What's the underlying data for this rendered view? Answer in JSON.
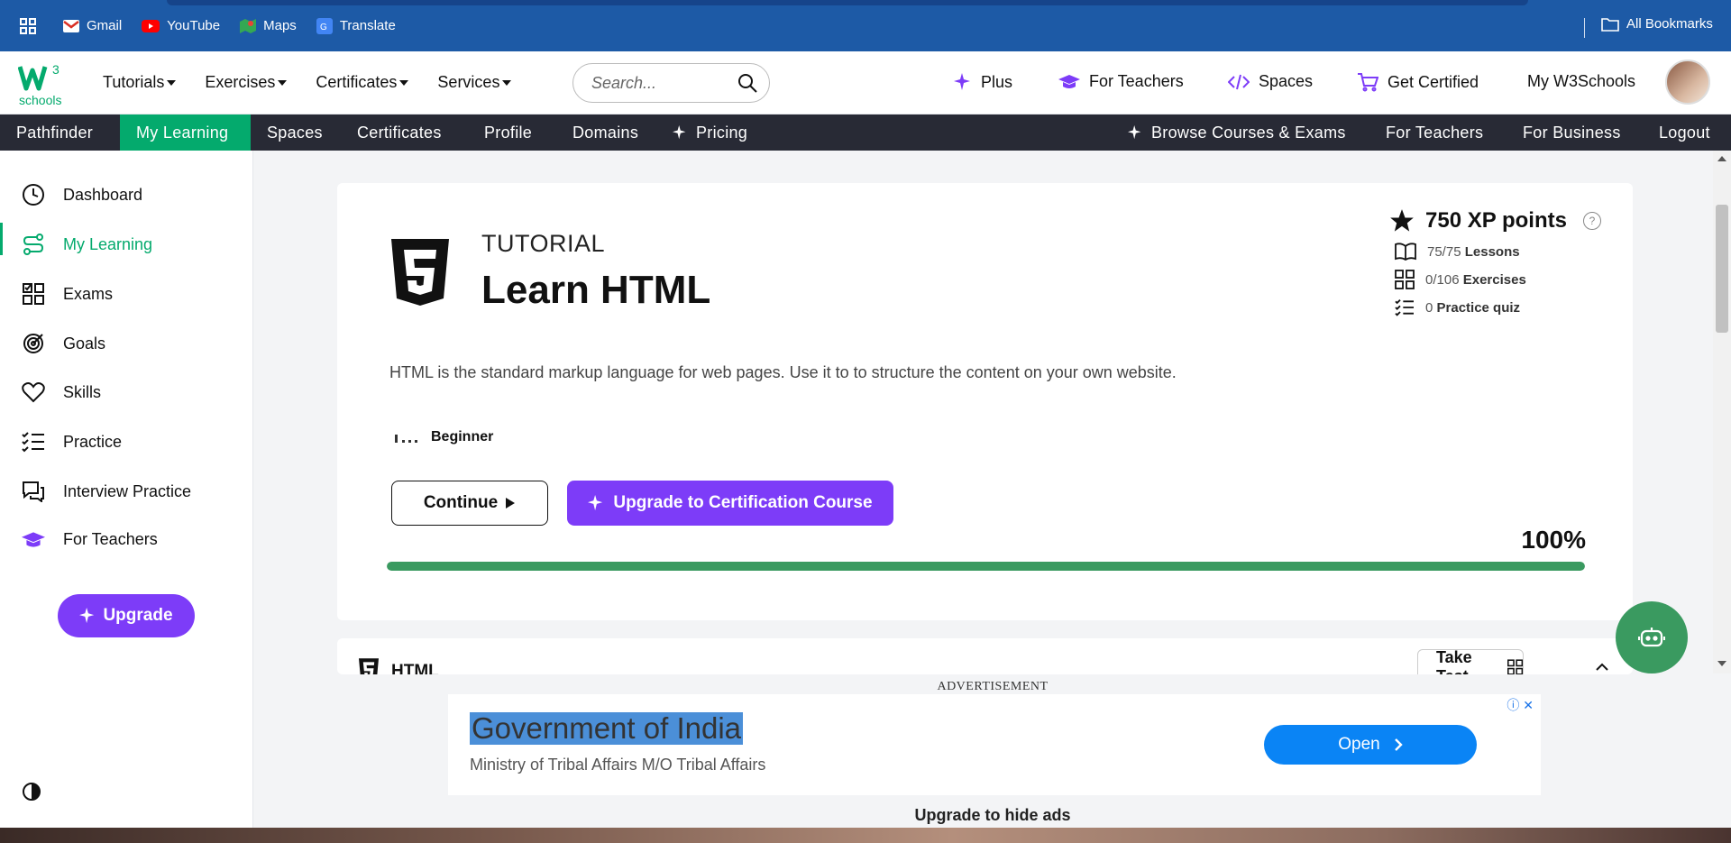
{
  "bookmarks": {
    "items": [
      "Gmail",
      "YouTube",
      "Maps",
      "Translate"
    ],
    "all_bookmarks": "All Bookmarks"
  },
  "nav_top": {
    "logo_text": "schools",
    "logo_sup": "3",
    "menu": [
      "Tutorials",
      "Exercises",
      "Certificates",
      "Services"
    ],
    "search_placeholder": "Search...",
    "right": [
      "Plus",
      "For Teachers",
      "Spaces",
      "Get Certified",
      "My W3Schools"
    ]
  },
  "nav_sub": {
    "left": [
      "Pathfinder",
      "My Learning",
      "Spaces",
      "Certificates",
      "Profile",
      "Domains",
      "Pricing"
    ],
    "right": [
      "Browse Courses & Exams",
      "For Teachers",
      "For Business",
      "Logout"
    ]
  },
  "sidebar": {
    "items": [
      "Dashboard",
      "My Learning",
      "Exams",
      "Goals",
      "Skills",
      "Practice",
      "Interview Practice",
      "For Teachers"
    ],
    "upgrade": "Upgrade"
  },
  "course": {
    "label": "TUTORIAL",
    "title": "Learn HTML",
    "description": "HTML is the standard markup language for web pages. Use it to to structure the content on your own website.",
    "level": "Beginner",
    "continue": "Continue",
    "upgrade_cert": "Upgrade to Certification Course",
    "progress_text": "100%",
    "progress_value": 1.0,
    "xp": "750 XP points",
    "lessons_count": "75/75",
    "lessons_label": "Lessons",
    "exercises_count": "0/106",
    "exercises_label": "Exercises",
    "quiz_count": "0",
    "quiz_label": "Practice quiz"
  },
  "section": {
    "title": "HTML",
    "take_test": "Take Test"
  },
  "ad": {
    "label": "ADVERTISEMENT",
    "headline": "Government of India",
    "subline": "Ministry of Tribal Affairs M/O Tribal Affairs",
    "cta": "Open",
    "hide": "Upgrade to hide ads"
  },
  "colors": {
    "accent_green": "#04aa6d",
    "purple": "#7d3cf8",
    "bookmark_bar": "#1d5aa6",
    "subnav": "#282a35"
  }
}
